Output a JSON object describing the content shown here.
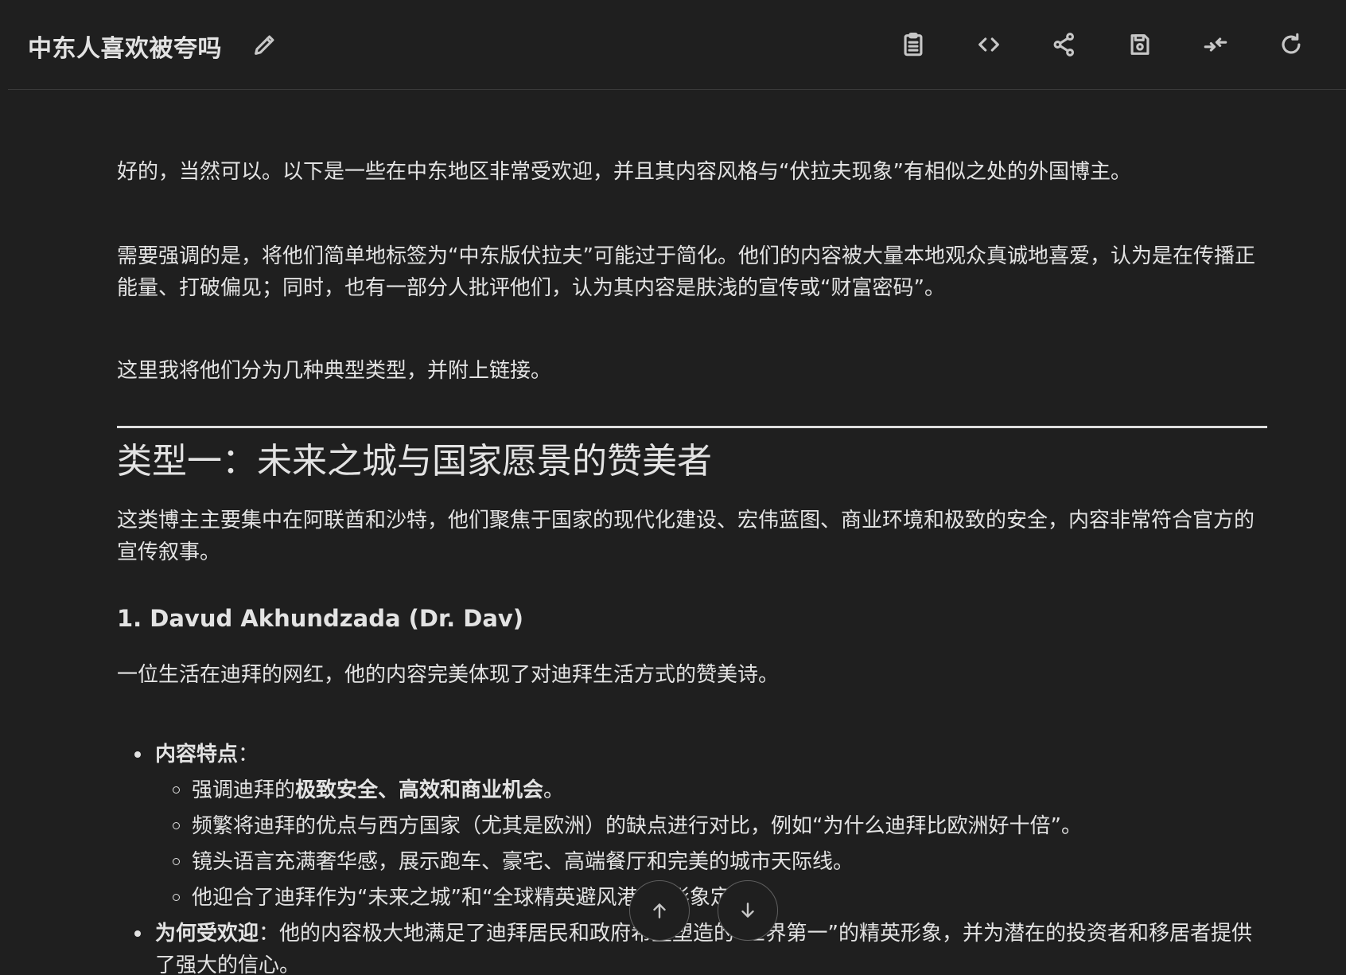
{
  "header": {
    "title": "中东人喜欢被夸吗",
    "icons": [
      "pencil-icon",
      "clipboard-icon",
      "code-icon",
      "share-icon",
      "save-icon",
      "collapse-icon",
      "refresh-icon"
    ]
  },
  "content": {
    "p1": "好的，当然可以。以下是一些在中东地区非常受欢迎，并且其内容风格与“伏拉夫现象”有相似之处的外国博主。",
    "p2": "需要强调的是，将他们简单地标签为“中东版伏拉夫”可能过于简化。他们的内容被大量本地观众真诚地喜爱，认为是在传播正能量、打破偏见；同时，也有一部分人批评他们，认为其内容是肤浅的宣传或“财富密码”。",
    "p3": "这里我将他们分为几种典型类型，并附上链接。",
    "h2": "类型一：未来之城与国家愿景的赞美者",
    "p4": "这类博主主要集中在阿联酋和沙特，他们聚焦于国家的现代化建设、宏伟蓝图、商业环境和极致的安全，内容非常符合官方的宣传叙事。",
    "h3": "1. Davud Akhundzada (Dr. Dav)",
    "p5": "一位生活在迪拜的网红，他的内容完美体现了对迪拜生活方式的赞美诗。",
    "bullet1_label": "内容特点",
    "bullet1_colon": "：",
    "sub1_prefix": "强调迪拜的",
    "sub1_bold": "极致安全、高效和商业机会",
    "sub1_suffix": "。",
    "sub2": "频繁将迪拜的优点与西方国家（尤其是欧洲）的缺点进行对比，例如“为什么迪拜比欧洲好十倍”。",
    "sub3": "镜头语言充满奢华感，展示跑车、豪宅、高端餐厅和完美的城市天际线。",
    "sub4": "他迎合了迪拜作为“未来之城”和“全球精英避风港”的形象定位。",
    "bullet2_label": "为何受欢迎",
    "bullet2_colon": "：",
    "bullet2_text": "他的内容极大地满足了迪拜居民和政府希望塑造的“世界第一”的精英形象，并为潜在的投资者和移居者提供了强大的信心。"
  }
}
